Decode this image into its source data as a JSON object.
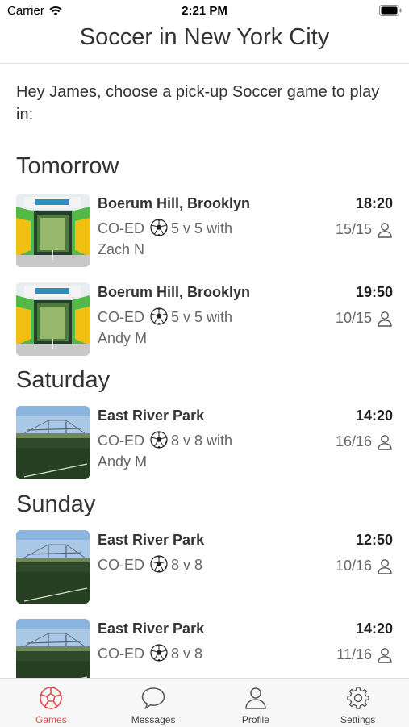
{
  "status_bar": {
    "carrier": "Carrier",
    "time": "2:21 PM"
  },
  "header": {
    "title": "Soccer in New York City"
  },
  "intro": {
    "text": "Hey James, choose a pick-up Soccer game to play in:"
  },
  "sections": [
    {
      "day": "Tomorrow"
    },
    {
      "day": "Saturday"
    },
    {
      "day": "Sunday"
    }
  ],
  "games": [
    {
      "location": "Boerum Hill, Brooklyn",
      "type": "CO-ED",
      "format": "5 v 5 with",
      "host": "Zach N",
      "time": "18:20",
      "count": "15/15",
      "image": "indoor-arena"
    },
    {
      "location": "Boerum Hill, Brooklyn",
      "type": "CO-ED",
      "format": "5 v 5 with",
      "host": "Andy M",
      "time": "19:50",
      "count": "10/15",
      "image": "indoor-arena"
    },
    {
      "location": "East River Park",
      "type": "CO-ED",
      "format": "8 v 8 with",
      "host": "Andy M",
      "time": "14:20",
      "count": "16/16",
      "image": "outdoor-field"
    },
    {
      "location": "East River Park",
      "type": "CO-ED",
      "format": "8 v 8",
      "host": "",
      "time": "12:50",
      "count": "10/16",
      "image": "outdoor-field"
    },
    {
      "location": "East River Park",
      "type": "CO-ED",
      "format": "8 v 8",
      "host": "",
      "time": "14:20",
      "count": "11/16",
      "image": "outdoor-field"
    }
  ],
  "tabs": [
    {
      "label": "Games",
      "icon": "soccer-ball-icon",
      "active": true
    },
    {
      "label": "Messages",
      "icon": "chat-bubble-icon",
      "active": false
    },
    {
      "label": "Profile",
      "icon": "person-icon",
      "active": false
    },
    {
      "label": "Settings",
      "icon": "gear-icon",
      "active": false
    }
  ],
  "colors": {
    "accent": "#e04b4b",
    "text": "#333333",
    "muted": "#666666"
  }
}
